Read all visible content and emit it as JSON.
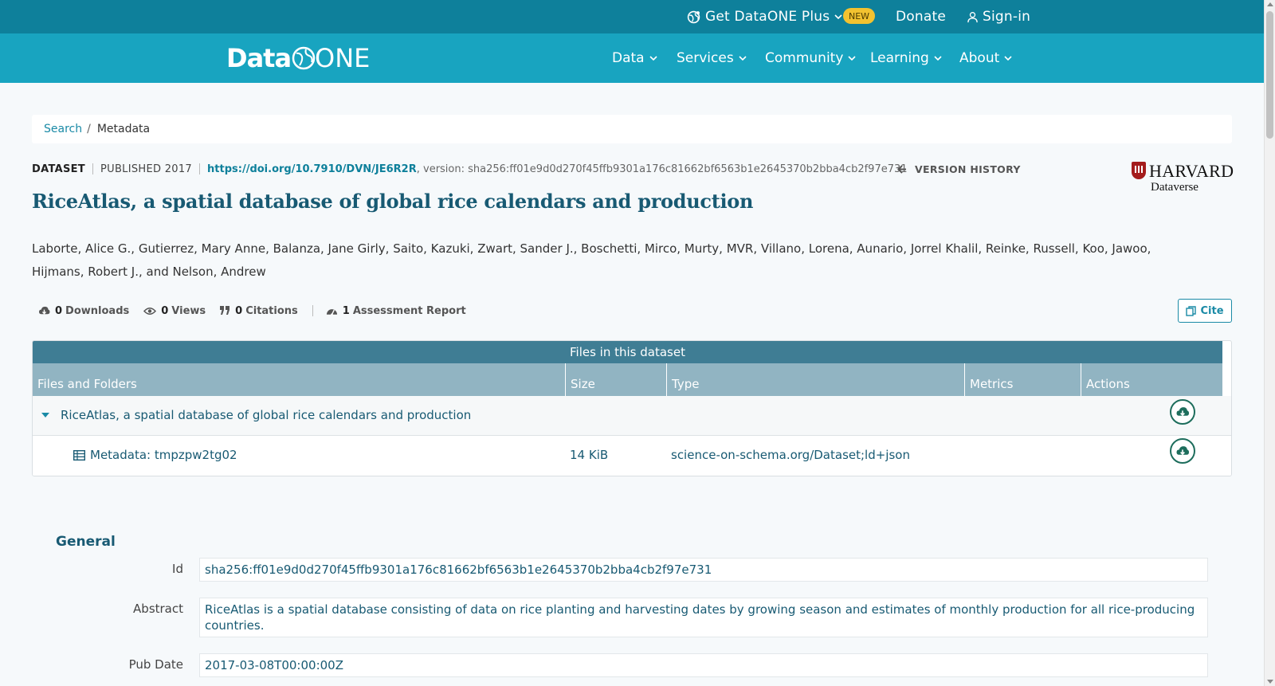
{
  "topbar": {
    "plus_label": "Get DataONE Plus",
    "new_badge": "NEW",
    "donate_label": "Donate",
    "signin_label": "Sign-in"
  },
  "navbar": {
    "logo_text_data": "Data",
    "logo_text_one": "ONE",
    "items": [
      {
        "label": "Data"
      },
      {
        "label": "Services"
      },
      {
        "label": "Community"
      },
      {
        "label": "Learning"
      },
      {
        "label": "About"
      }
    ]
  },
  "breadcrumb": {
    "search": "Search",
    "separator": "/",
    "current": "Metadata"
  },
  "dataset": {
    "type_label": "DATASET",
    "published": "PUBLISHED 2017",
    "doi": "https://doi.org/10.7910/DVN/JE6R2R",
    "version": ", version: sha256:ff01e9d0d270f45ffb9301a176c81662bf6563b1e2645370b2bba4cb2f97e731",
    "version_history": "VERSION HISTORY",
    "title": "RiceAtlas, a spatial database of global rice calendars and production",
    "authors": "Laborte, Alice G., Gutierrez, Mary Anne, Balanza, Jane Girly, Saito, Kazuki, Zwart, Sander J., Boschetti, Mirco, Murty, MVR, Villano, Lorena, Aunario, Jorrel Khalil, Reinke, Russell, Koo, Jawoo, Hijmans, Robert J., and Nelson, Andrew",
    "repository": {
      "name": "HARVARD",
      "sub": "Dataverse"
    }
  },
  "metrics": {
    "downloads": {
      "count": "0",
      "label": "Downloads"
    },
    "views": {
      "count": "0",
      "label": "Views"
    },
    "citations": {
      "count": "0",
      "label": "Citations"
    },
    "assessment": {
      "count": "1",
      "label": "Assessment Report"
    },
    "cite_label": "Cite"
  },
  "files": {
    "caption": "Files in this dataset",
    "columns": [
      "Files and Folders",
      "Size",
      "Type",
      "Metrics",
      "Actions"
    ],
    "package_row": {
      "name": "RiceAtlas, a spatial database of global rice calendars and production"
    },
    "file_row": {
      "name": "Metadata: tmpzpw2tg02",
      "size": "14 KiB",
      "type": "science-on-schema.org/Dataset;ld+json"
    }
  },
  "general": {
    "title": "General",
    "fields": [
      {
        "label": "Id",
        "value": "sha256:ff01e9d0d270f45ffb9301a176c81662bf6563b1e2645370b2bba4cb2f97e731"
      },
      {
        "label": "Abstract",
        "value": "RiceAtlas is a spatial database consisting of data on rice planting and harvesting dates by growing season and estimates of monthly production for all rice-producing countries."
      },
      {
        "label": "Pub Date",
        "value": "2017-03-08T00:00:00Z"
      }
    ]
  },
  "colors": {
    "topbar": "#0e809b",
    "navbar": "#18a4c0",
    "title": "#185a73",
    "badge": "#f2c230"
  }
}
